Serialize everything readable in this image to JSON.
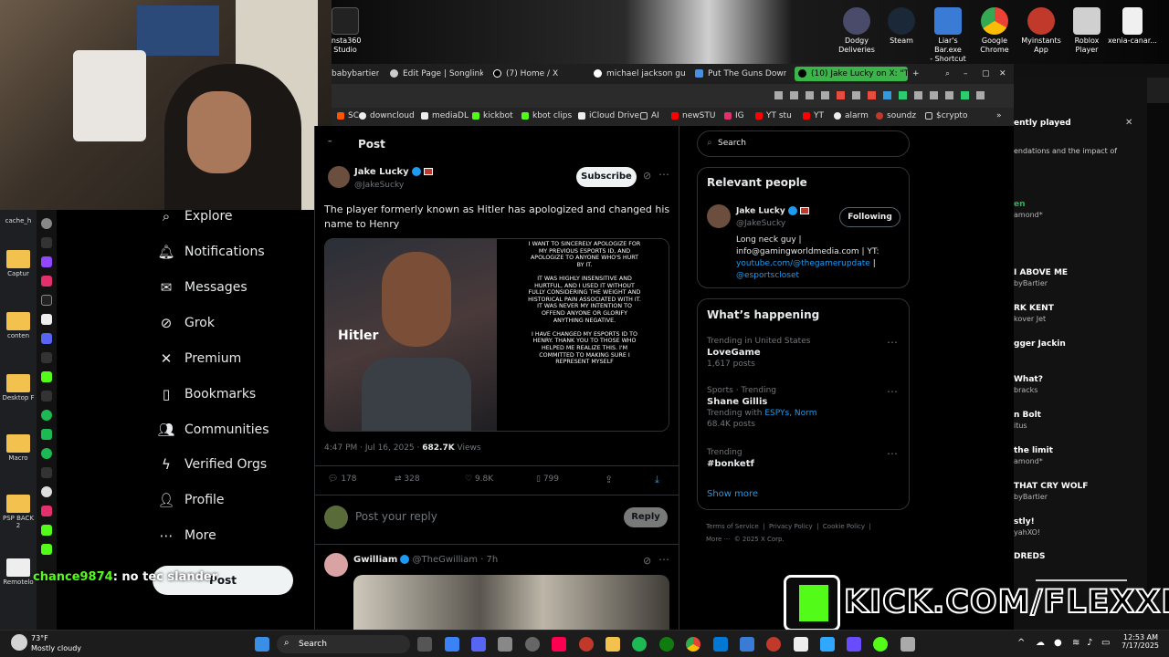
{
  "desktop": {
    "icons": [
      {
        "label": "Insta360\nStudio"
      },
      {
        "label": "Dodgy\nDeliveries"
      },
      {
        "label": "Steam"
      },
      {
        "label": "Liar's Bar.exe\n- Shortcut"
      },
      {
        "label": "Google\nChrome"
      },
      {
        "label": "Myinstants\nApp"
      },
      {
        "label": "Roblox Player"
      },
      {
        "label": "xenia-canar..."
      }
    ],
    "left_icons": [
      {
        "label": "cache_h"
      },
      {
        "label": "Captur"
      },
      {
        "label": "conten"
      },
      {
        "label": "Desktop F"
      },
      {
        "label": "Macro"
      },
      {
        "label": "PSP BACK\n2"
      },
      {
        "label": "Remotelo"
      }
    ]
  },
  "browser": {
    "tabs": [
      {
        "label": "babybartier"
      },
      {
        "label": "Edit Page | Songlink/"
      },
      {
        "label": "(7) Home / X"
      },
      {
        "label": "michael jackson gun"
      },
      {
        "label": "Put The Guns Down"
      },
      {
        "label": "(10) Jake Lucky on X: \"Th"
      }
    ],
    "bookmarks": [
      {
        "label": "SC"
      },
      {
        "label": "downcloud"
      },
      {
        "label": "mediaDL"
      },
      {
        "label": "kickbot"
      },
      {
        "label": "kbot clips"
      },
      {
        "label": "iCloud Drive"
      },
      {
        "label": "AI"
      },
      {
        "label": "newSTU"
      },
      {
        "label": "IG"
      },
      {
        "label": "YT stu"
      },
      {
        "label": "YT"
      },
      {
        "label": "alarm"
      },
      {
        "label": "soundz"
      },
      {
        "label": "$crypto"
      }
    ]
  },
  "nav": {
    "items": [
      {
        "label": "Explore",
        "icon": "search-icon"
      },
      {
        "label": "Notifications",
        "icon": "bell-icon"
      },
      {
        "label": "Messages",
        "icon": "mail-icon"
      },
      {
        "label": "Grok",
        "icon": "grok-icon"
      },
      {
        "label": "Premium",
        "icon": "x-logo-icon"
      },
      {
        "label": "Bookmarks",
        "icon": "bookmark-icon"
      },
      {
        "label": "Communities",
        "icon": "people-icon"
      },
      {
        "label": "Verified Orgs",
        "icon": "lightning-icon"
      },
      {
        "label": "Profile",
        "icon": "person-icon"
      },
      {
        "label": "More",
        "icon": "more-circle-icon"
      }
    ],
    "post_label": "Post"
  },
  "chat": {
    "user": "chance9874",
    "message": ": no tec slander"
  },
  "post": {
    "header": "Post",
    "author": "Jake Lucky",
    "handle": "@JakeSucky",
    "subscribe": "Subscribe",
    "text": "The player formerly known as Hitler has apologized and changed his name to Henry",
    "image_overlay": "Hitler",
    "statement": "I WANT TO SINCERELY APOLOGIZE FOR MY PREVIOUS ESPORTS ID, AND APOLOGIZE TO ANYONE WHO'S HURT BY IT.\n\nIT WAS HIGHLY INSENSITIVE AND HURTFUL, AND I USED IT WITHOUT FULLY CONSIDERING THE WEIGHT AND HISTORICAL PAIN ASSOCIATED WITH IT. IT WAS NEVER MY INTENTION TO OFFEND ANYONE OR GLORIFY ANYTHING NEGATIVE.\n\nI HAVE CHANGED MY ESPORTS ID TO HENRY. THANK YOU TO THOSE WHO HELPED ME REALIZE THIS. I'M COMMITTED TO MAKING SURE I REPRESENT MYSELF",
    "time": "4:47 PM · Jul 16, 2025 · ",
    "views": "682.7K",
    "views_label": " Views",
    "replies": "178",
    "reposts": "328",
    "likes": "9.8K",
    "bookmarks": "799",
    "reply_placeholder": "Post your reply",
    "reply_button": "Reply"
  },
  "reply": {
    "author": "Gwilliam",
    "handle": "@TheGwilliam · 7h"
  },
  "sidebar": {
    "search_placeholder": "Search",
    "relevant_title": "Relevant people",
    "person_name": "Jake Lucky",
    "person_handle": "@JakeSucky",
    "following": "Following",
    "bio_line1": "Long neck guy |",
    "bio_line2": "info@gamingworldmedia.com | YT:",
    "bio_link1": "youtube.com/@thegamerupdate",
    "bio_sep": " |",
    "bio_link2": "@esportscloset",
    "happening_title": "What’s happening",
    "trends": [
      {
        "context": "Trending in United States",
        "name": "LoveGame",
        "meta": "1,617 posts"
      },
      {
        "context": "Sports · Trending",
        "name": "Shane Gillis",
        "meta_prefix": "Trending with ",
        "meta_link": "ESPYs, Norm",
        "meta2": "68.4K posts"
      },
      {
        "context": "Trending",
        "name": "#bonketf",
        "meta": ""
      }
    ],
    "show_more": "Show more",
    "footer1": "Terms of Service  |  Privacy Policy  |  Cookie Policy  |",
    "footer2": "More ···  © 2025 X Corp."
  },
  "side_panel": {
    "header": "ently played",
    "sub": "endations and the impact of",
    "songs": [
      {
        "title": "en",
        "artist": "amond*"
      },
      {
        "title": "I ABOVE ME",
        "artist": "byBartier"
      },
      {
        "title": "RK KENT",
        "artist": "kover Jet"
      },
      {
        "title": "gger Jackin",
        "artist": ""
      },
      {
        "title": "What?",
        "artist": "bracks"
      },
      {
        "title": "n Bolt",
        "artist": "itus"
      },
      {
        "title": "the limit",
        "artist": "amond*"
      },
      {
        "title": "THAT CRY WOLF",
        "artist": "byBartier"
      },
      {
        "title": "stly!",
        "artist": "yahXO!"
      },
      {
        "title": "DREDS",
        "artist": ""
      }
    ]
  },
  "kick": {
    "text": "KICK.COM/FLEXXICO"
  },
  "taskbar": {
    "weather_temp": "73°F",
    "weather_desc": "Mostly cloudy",
    "search": "Search",
    "time": "12:53 AM",
    "date": "7/17/2025"
  },
  "colors": {
    "accent": "#1d9bf0",
    "kick_green": "#53fc18",
    "tab_active": "#3bb44a"
  }
}
